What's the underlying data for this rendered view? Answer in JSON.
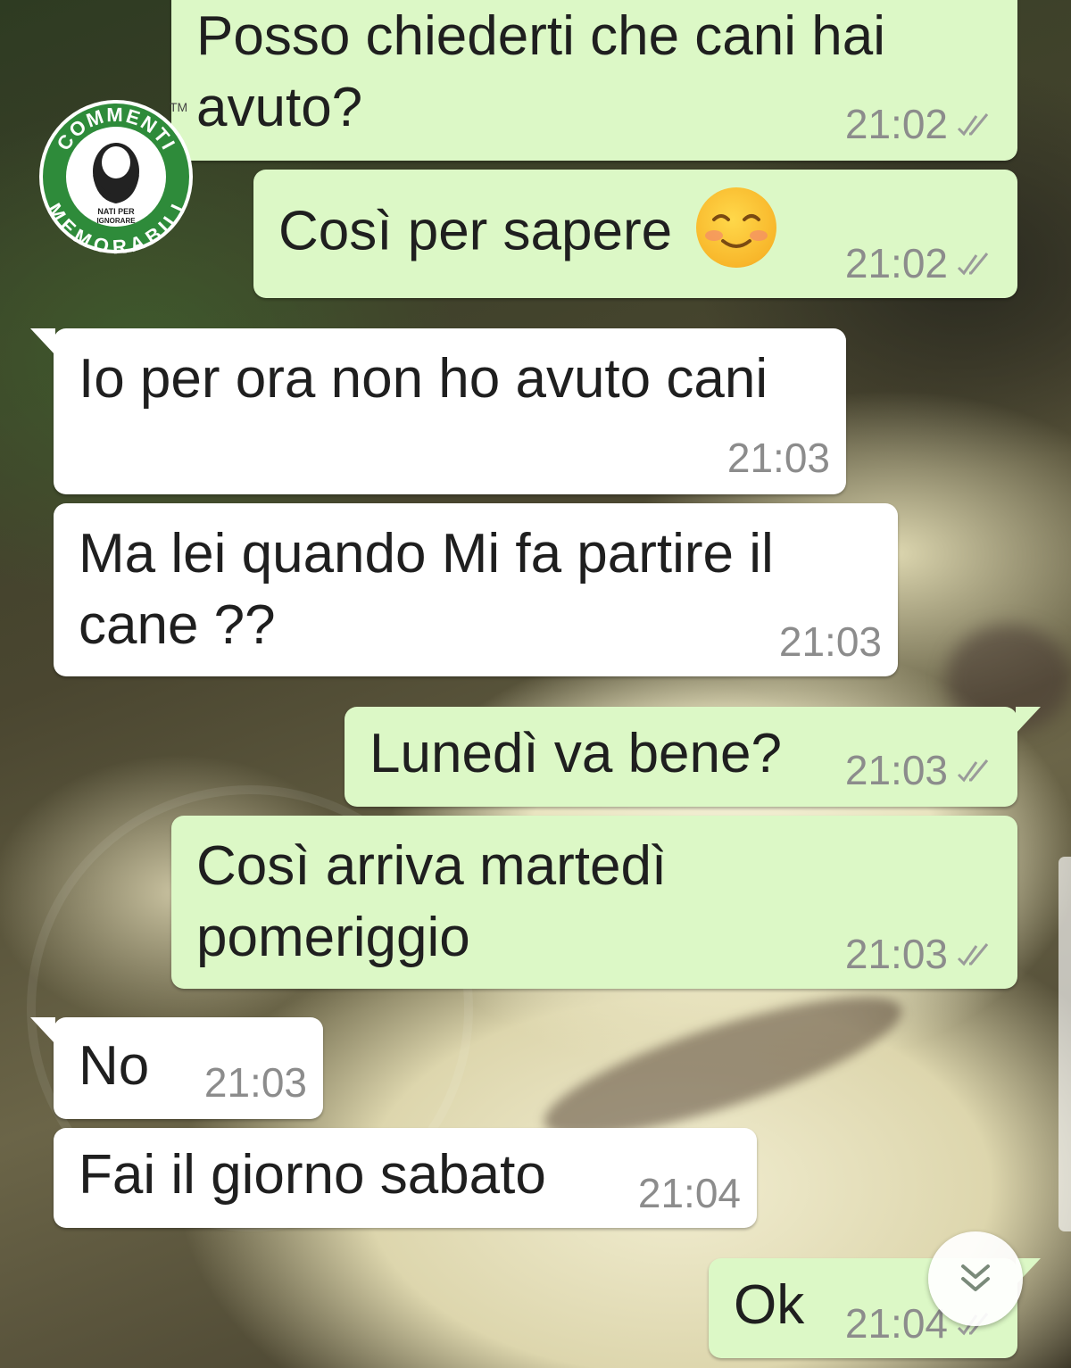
{
  "brand": {
    "logo_top": "COMMENTI",
    "logo_bottom": "MEMORABILI",
    "logo_tag_line1": "NATI PER",
    "logo_tag_line2": "IGNORARE",
    "trademark": "TM"
  },
  "colors": {
    "incoming_bubble": "#ffffff",
    "outgoing_bubble": "#dcf8c6",
    "timestamp": "#8c8c8c",
    "logo_green": "#2e8b3a"
  },
  "messages": [
    {
      "direction": "outgoing",
      "lines": [
        "Posso chiederti che cani hai",
        "avuto?"
      ],
      "time": "21:02",
      "status_icon": "double-check-icon"
    },
    {
      "direction": "outgoing",
      "lines": [
        "Così per sapere"
      ],
      "emoji": "smiling-face-with-blush-emoji",
      "time": "21:02",
      "status_icon": "double-check-icon"
    },
    {
      "direction": "incoming",
      "lines": [
        "Io per ora non ho avuto cani"
      ],
      "time": "21:03"
    },
    {
      "direction": "incoming",
      "lines": [
        "Ma lei quando Mi fa partire il",
        "cane ??"
      ],
      "time": "21:03"
    },
    {
      "direction": "outgoing",
      "lines": [
        "Lunedì va bene?"
      ],
      "time": "21:03",
      "status_icon": "double-check-icon"
    },
    {
      "direction": "outgoing",
      "lines": [
        "Così arriva martedì",
        "pomeriggio"
      ],
      "time": "21:03",
      "status_icon": "double-check-icon"
    },
    {
      "direction": "incoming",
      "lines": [
        "No"
      ],
      "time": "21:03"
    },
    {
      "direction": "incoming",
      "lines": [
        "Fai il giorno sabato"
      ],
      "time": "21:04"
    },
    {
      "direction": "outgoing",
      "lines": [
        "Ok"
      ],
      "time": "21:04",
      "status_icon": "double-check-icon"
    }
  ],
  "scroll_button_icon": "double-chevron-down-icon"
}
